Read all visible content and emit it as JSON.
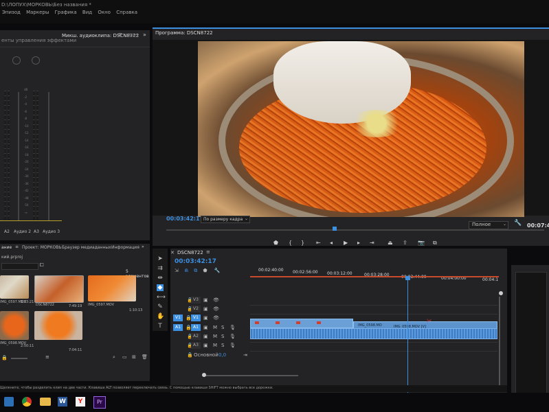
{
  "window": {
    "title": "D:\\ЛОПУХ\\МОРКОВЬ\\Без названия *"
  },
  "menu": [
    "Эпизод",
    "Маркеры",
    "Графика",
    "Вид",
    "Окно",
    "Справка"
  ],
  "effects_panel": {
    "title": "енты управления эффектами",
    "tab_mixer": "Микш. аудиоклипа: DSCN8722",
    "tab_meta": "Мет"
  },
  "audio_mixer": {
    "scale": [
      "dB",
      "-2",
      "-4",
      "-6",
      "-8",
      "-10",
      "-12",
      "-14",
      "-16",
      "-18",
      "-20",
      "-24",
      "-30",
      "-36",
      "-42",
      "-48",
      "-54",
      "-∞"
    ],
    "channels": [
      {
        "code": "A2",
        "name": "Аудио 2"
      },
      {
        "code": "A3",
        "name": "Аудио 3"
      }
    ]
  },
  "program": {
    "title": "Программа: DSCN8722",
    "timecode": "00:03:42:17",
    "fit": "По размеру кадра",
    "quality": "Полное",
    "end_timecode": "00:07:4"
  },
  "project": {
    "tabs": [
      "ание",
      "Проект: МОРКОВЬ",
      "Браузер медиаданных",
      "Информация"
    ],
    "file": "кий.prproj",
    "count": "5 элементов",
    "items": [
      {
        "name": "IMG_0597.MOV",
        "duration": "3:33:21"
      },
      {
        "name": "DSCN8722",
        "duration": ""
      },
      {
        "name": "IMG_0597.MOV",
        "duration": "7:49:19"
      },
      {
        "name": "",
        "duration": "1:10:13"
      },
      {
        "name": "IMG_0598.MOV",
        "duration": "2:50:11"
      },
      {
        "name": "",
        "duration": "7:04:11"
      }
    ]
  },
  "timeline": {
    "tab": "DSCN8722",
    "timecode": "00:03:42:17",
    "ruler": [
      "00:02:40:00",
      "00:02:56:00",
      "00:03:12:00",
      "00:03:28:00",
      "00:03:44:00",
      "00:04:00:00",
      "00:04:1"
    ],
    "tracks": [
      {
        "code": "",
        "target": "V3"
      },
      {
        "code": "",
        "target": "V2"
      },
      {
        "code": "V1",
        "target": "V1"
      },
      {
        "code": "A1",
        "target": "A1"
      },
      {
        "code": "",
        "target": "A2"
      },
      {
        "code": "",
        "target": "A3"
      }
    ],
    "master": {
      "label": "Основной",
      "value": "0,0"
    },
    "clip_1": "IMG_0598.MO",
    "clip_2": "IMG_0598.MOV [V]"
  },
  "status": "Щелкните, чтобы разделить клип на две части. Клавиша ALT позволяет переключать связь. С помощью клавиши SHIFT можно выбрать все дорожки.",
  "taskbar": {
    "word": "W",
    "yandex": "Y",
    "premiere": "Pr"
  },
  "colors": {
    "accent": "#3d8fe0",
    "panel": "#232325",
    "clip": "#6ba0d6",
    "playhead": "#3d8fe0"
  }
}
